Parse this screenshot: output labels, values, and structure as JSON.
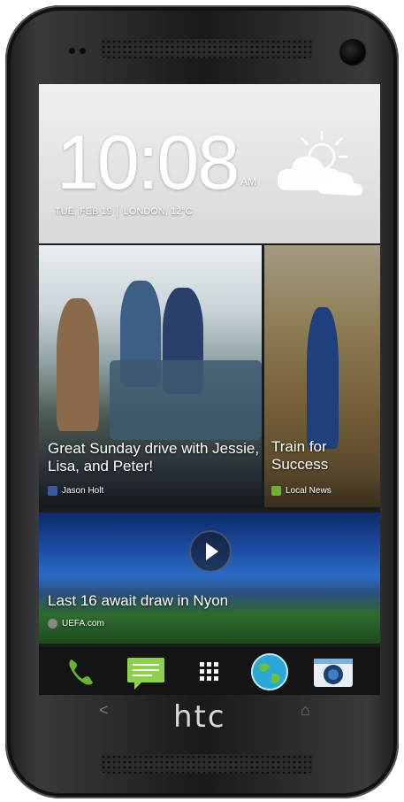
{
  "lockscreen": {
    "time": "10:08",
    "ampm": "AM",
    "date_line": "TUE, FEB 19 │ LONDON, 12°C",
    "weather_icon": "partly-cloudy-icon"
  },
  "feed": {
    "tile1": {
      "headline": "Great Sunday drive with Jessie, Lisa, and Peter!",
      "source": "Jason Holt",
      "source_icon": "facebook-icon"
    },
    "tile2": {
      "headline": "Train for Success",
      "source": "Local News",
      "source_icon": "news-icon"
    },
    "tile3": {
      "headline": "Last 16 await draw in Nyon",
      "source": "UEFA.com",
      "source_icon": "uefa-icon"
    }
  },
  "dock": {
    "items": [
      "phone-icon",
      "messages-icon",
      "apps-grid-icon",
      "browser-globe-icon",
      "camera-icon"
    ]
  },
  "hardware": {
    "brand": "htc",
    "nav_back": "<",
    "nav_home": "⌂"
  },
  "colors": {
    "accent_green": "#6ab42d",
    "screen_bg": "#1b1b1b"
  }
}
